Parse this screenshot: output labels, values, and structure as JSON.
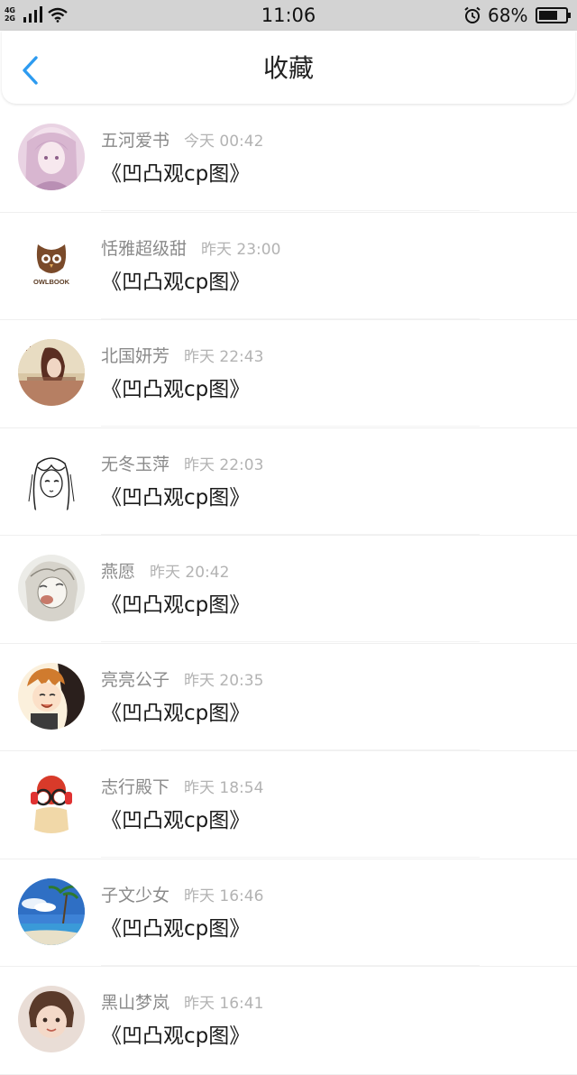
{
  "status_bar": {
    "network_top": "4G",
    "network_bottom": "2G",
    "time": "11:06",
    "battery": "68%"
  },
  "header": {
    "title": "收藏"
  },
  "colors": {
    "accent": "#2d9bf0",
    "status_bar_bg": "#d3d3d3"
  },
  "items": [
    {
      "author": "五河爱书",
      "time": "今天 00:42",
      "title": "《凹凸观cp图》"
    },
    {
      "author": "恬雅超级甜",
      "time": "昨天 23:00",
      "title": "《凹凸观cp图》"
    },
    {
      "author": "北国妍芳",
      "time": "昨天 22:43",
      "title": "《凹凸观cp图》"
    },
    {
      "author": "无冬玉萍",
      "time": "昨天 22:03",
      "title": "《凹凸观cp图》"
    },
    {
      "author": "燕愿",
      "time": "昨天 20:42",
      "title": "《凹凸观cp图》"
    },
    {
      "author": "亮亮公子",
      "time": "昨天 20:35",
      "title": "《凹凸观cp图》"
    },
    {
      "author": "志行殿下",
      "time": "昨天 18:54",
      "title": "《凹凸观cp图》"
    },
    {
      "author": "子文少女",
      "time": "昨天 16:46",
      "title": "《凹凸观cp图》"
    },
    {
      "author": "黑山梦岚",
      "time": "昨天 16:41",
      "title": "《凹凸观cp图》"
    }
  ],
  "avatar_logo_text": "OWLBOOK"
}
